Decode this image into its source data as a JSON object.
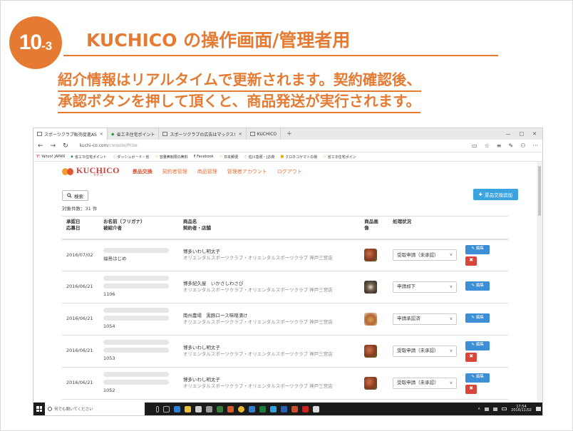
{
  "slide": {
    "badge_number": "10",
    "badge_sub": "-3",
    "title": "KUCHICO の操作画面/管理者用",
    "subtitle_line1": "紹介情報はリアルタイムで更新されます。契約確認後、",
    "subtitle_line2": "承認ボタンを押して頂くと、商品発送が実行されます。",
    "accent_color": "#e57b33"
  },
  "browser": {
    "tabs": [
      {
        "label": "スポーツクラブ販売促進AS",
        "active": true,
        "close": "✕"
      },
      {
        "label": "省エネ住宅ポイント",
        "active": false,
        "close": ""
      },
      {
        "label": "スポーツクラブの広告はマックス!",
        "active": false,
        "close": "✕"
      },
      {
        "label": "KUCHICO",
        "active": false,
        "close": ""
      }
    ],
    "new_tab": "+",
    "window_controls": [
      "—",
      "□",
      "✕"
    ],
    "back": "←",
    "forward": "→",
    "refresh": "↻",
    "url_main": "kuchi-co.com",
    "url_path": "/console/Prize",
    "toolbar_icons": [
      "▭",
      "☆",
      "≡",
      "✎",
      "⚇",
      "···"
    ],
    "favorites": [
      {
        "icon": "Y!",
        "label": "Yahoo! JAPAN"
      },
      {
        "icon": "◆",
        "label": "省エネ住宅ポイント"
      },
      {
        "icon": "☆",
        "label": "ダッシュボード・省"
      },
      {
        "icon": "☆",
        "label": "容量無制限の無料"
      },
      {
        "icon": "f",
        "label": "Facebook"
      },
      {
        "icon": "☆",
        "label": "日本郵便"
      },
      {
        "icon": "☆",
        "label": "佐川急便・[お荷"
      },
      {
        "icon": "■",
        "label": "クロネコヤマトの荷"
      },
      {
        "icon": "☆",
        "label": "省エネ住宅ポイン"
      }
    ]
  },
  "app": {
    "logo_text": "KUCHICO",
    "logo_kana": "クチコ",
    "nav": [
      {
        "label": "景品交換",
        "active": true
      },
      {
        "label": "契約者管理",
        "active": false
      },
      {
        "label": "商品管理",
        "active": false
      },
      {
        "label": "管理者アカウント",
        "active": false
      },
      {
        "label": "ログアウト",
        "active": false
      }
    ],
    "search_label": "検索",
    "add_label": "景品交換追加",
    "count_text": "対象件数：31 件",
    "columns": {
      "date_line1": "承認日",
      "date_line2": "応募日",
      "name_line1": "お名前（フリガナ）",
      "name_line2": "被紹介者",
      "product_line1": "商品名",
      "product_line2": "契約者・店舗",
      "image_line1": "商品画",
      "image_line2": "像",
      "status": "処理状況"
    },
    "rows": [
      {
        "date": "2016/07/02",
        "name_id": "福島はじめ",
        "product": "博多いわし明太子",
        "store": "オリエンタルスポーツクラブ・オリエンタルスポーツクラブ 神戸三宮店",
        "thumb": "t1",
        "status": "受取申請（未承認）"
      },
      {
        "date": "2016/06/21",
        "name_id": "1106",
        "product": "博多紀久屋　いかさしわさび",
        "store": "オリエンタルスポーツクラブ・オリエンタルスポーツクラブ 神戸三宮店",
        "thumb": "t2",
        "status": "申請却下"
      },
      {
        "date": "2016/06/21",
        "name_id": "1054",
        "product": "南州農場　黒豚ロース味噌漬け",
        "store": "オリエンタルスポーツクラブ・オリエンタルスポーツクラブ 神戸三宮店",
        "thumb": "t3",
        "status": "申請承認済"
      },
      {
        "date": "2016/06/21",
        "name_id": "1053",
        "product": "博多いわし明太子",
        "store": "オリエンタルスポーツクラブ・オリエンタルスポーツクラブ 神戸三宮店",
        "thumb": "t1",
        "status": "受取申請（未承認）"
      },
      {
        "date": "2016/06/21",
        "name_id": "1052",
        "product": "博多いわし明太子",
        "store": "オリエンタルスポーツクラブ・オリエンタルスポーツクラブ 神戸三宮店",
        "thumb": "t1",
        "status": "受取申請（未承認）"
      }
    ],
    "edit_label": "編集",
    "delete_label": "✖"
  },
  "taskbar": {
    "search_placeholder": "何でも聞いてください",
    "time": "17:54",
    "date": "2016/11/02"
  }
}
